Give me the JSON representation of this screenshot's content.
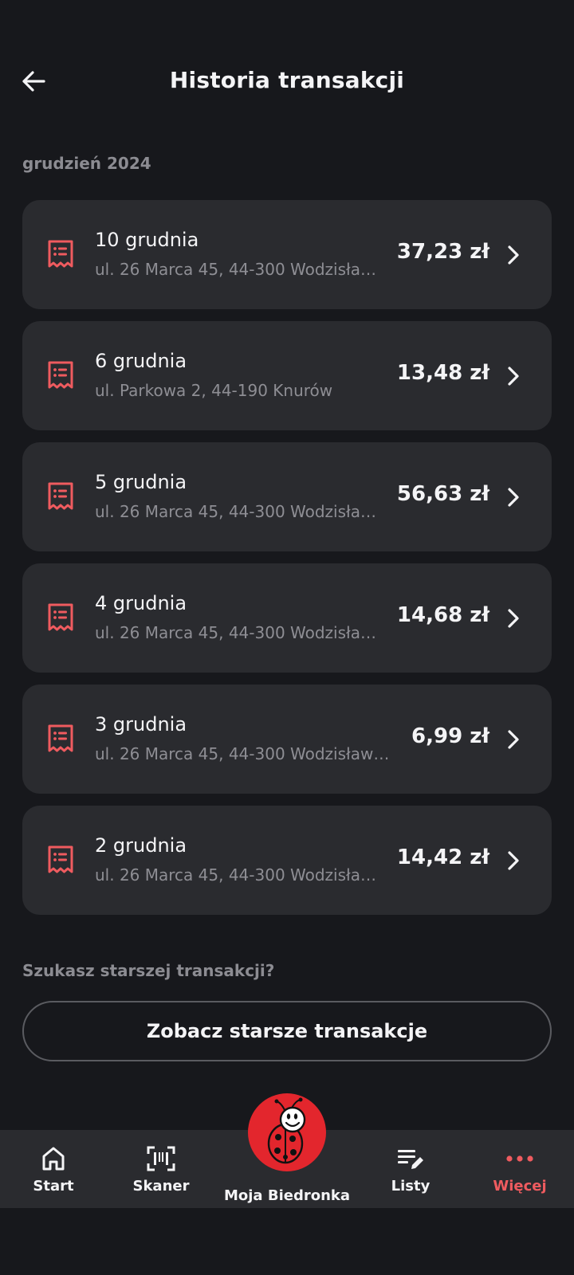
{
  "header": {
    "title": "Historia transakcji"
  },
  "month": "grudzień 2024",
  "transactions": [
    {
      "date": "10 grudnia",
      "address": "ul. 26 Marca 45, 44-300 Wodzisła…",
      "amount": "37,23 zł"
    },
    {
      "date": "6 grudnia",
      "address": "ul. Parkowa 2, 44-190 Knurów",
      "amount": "13,48 zł"
    },
    {
      "date": "5 grudnia",
      "address": "ul. 26 Marca 45, 44-300 Wodzisła…",
      "amount": "56,63 zł"
    },
    {
      "date": "4 grudnia",
      "address": "ul. 26 Marca 45, 44-300 Wodzisła…",
      "amount": "14,68 zł"
    },
    {
      "date": "3 grudnia",
      "address": "ul. 26 Marca 45, 44-300 Wodzisław…",
      "amount": "6,99 zł"
    },
    {
      "date": "2 grudnia",
      "address": "ul. 26 Marca 45, 44-300 Wodzisła…",
      "amount": "14,42 zł"
    }
  ],
  "older": {
    "question": "Szukasz starszej transakcji?",
    "button": "Zobacz starsze transakcje"
  },
  "nav": {
    "start": "Start",
    "scanner": "Skaner",
    "center": "Moja Biedronka",
    "lists": "Listy",
    "more": "Więcej",
    "active": "more"
  },
  "colors": {
    "background": "#17181c",
    "card": "#2a2b2f",
    "accent": "#ef5b5f",
    "brand_red": "#e3262d"
  },
  "icons": {
    "back": "arrow-left-icon",
    "receipt": "receipt-icon",
    "chevron": "chevron-right-icon",
    "home": "home-icon",
    "scanner": "barcode-scanner-icon",
    "mascot": "ladybug-mascot-icon",
    "lists": "list-edit-icon",
    "more": "more-dots-icon"
  }
}
